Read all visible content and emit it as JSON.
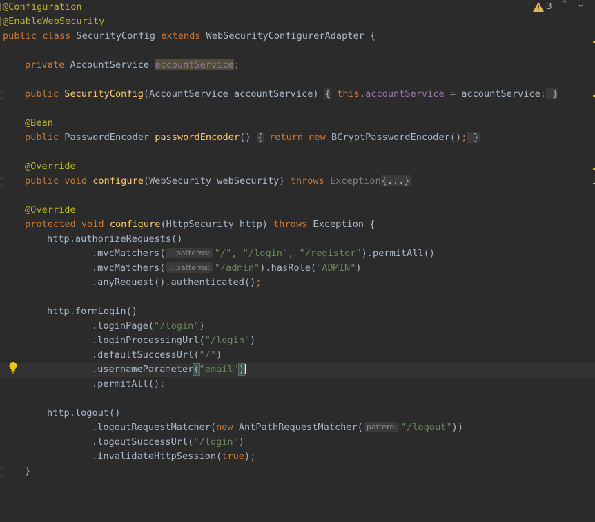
{
  "inspection": {
    "warning_count": "3",
    "up_arrow": "⌃",
    "down_arrow": "⌄"
  },
  "code": {
    "l1": {
      "a": "@Configuration"
    },
    "l2": {
      "a": "@EnableWebSecurity"
    },
    "l3": {
      "k1": "public class ",
      "name": "SecurityConfig ",
      "k2": "extends ",
      "parent": "WebSecurityConfigurerAdapter {"
    },
    "l5": {
      "k1": "private ",
      "type": "AccountService ",
      "field": "accountService",
      "semi": ";"
    },
    "l7": {
      "k1": "public ",
      "fn": "SecurityConfig",
      "args": "(AccountService accountService) ",
      "b1": "{",
      "this": " this",
      "dot": ".",
      "field": "accountService",
      "eq": " = accountService",
      "semi": ";",
      "b2": " }"
    },
    "l9": {
      "a": "@Bean"
    },
    "l10": {
      "k1": "public ",
      "type": "PasswordEncoder ",
      "fn": "passwordEncoder",
      "args": "() ",
      "b1": "{",
      "ret": " return new ",
      "ctor": "BCryptPasswordEncoder()",
      "semi": ";",
      "b2": " }"
    },
    "l12": {
      "a": "@Override"
    },
    "l13": {
      "k1": "public void ",
      "fn": "configure",
      "args": "(WebSecurity webSecurity) ",
      "k2": "throws ",
      "exc": "Exception",
      "fold": "{...}"
    },
    "l15": {
      "a": "@Override"
    },
    "l16": {
      "k1": "protected void ",
      "fn": "configure",
      "args": "(HttpSecurity http) ",
      "k2": "throws ",
      "exc": "Exception {"
    },
    "l17": {
      "t": "http.authorizeRequests()"
    },
    "l18": {
      "t1": ".mvcMatchers(",
      "hint": "...patterns:",
      "s1": "\"/\"",
      "c1": ", ",
      "s2": "\"/login\"",
      "c2": ", ",
      "s3": "\"/register\"",
      "t2": ").permitAll()"
    },
    "l19": {
      "t1": ".mvcMatchers(",
      "hint": "...patterns:",
      "s1": "\"/admin\"",
      "t2": ").hasRole(",
      "s2": "\"ADMIN\"",
      "t3": ")"
    },
    "l20": {
      "t": ".anyRequest().authenticated()",
      "semi": ";"
    },
    "l22": {
      "t": "http.formLogin()"
    },
    "l23": {
      "t1": ".loginPage(",
      "s": "\"/login\"",
      "t2": ")"
    },
    "l24": {
      "t1": ".loginProcessingUrl(",
      "s": "\"/login\"",
      "t2": ")"
    },
    "l25": {
      "t1": ".defaultSuccessUrl(",
      "s": "\"/\"",
      "t2": ")"
    },
    "l26": {
      "t1": ".usernameParameter",
      "p1": "(",
      "s": "\"email\"",
      "p2": ")"
    },
    "l27": {
      "t": ".permitAll()",
      "semi": ";"
    },
    "l29": {
      "t": "http.logout()"
    },
    "l30": {
      "t1": ".logoutRequestMatcher(",
      "k": "new ",
      "t2": "AntPathRequestMatcher(",
      "hint": "pattern:",
      "s": "\"/logout\"",
      "t3": "))"
    },
    "l31": {
      "t1": ".logoutSuccessUrl(",
      "s": "\"/login\"",
      "t2": ")"
    },
    "l32": {
      "t1": ".invalidateHttpSession(",
      "k": "true",
      "t2": ")",
      "semi": ";"
    },
    "l33": {
      "t": "}"
    }
  },
  "colors": {
    "background": "#2b2b2b",
    "keyword": "#cc7832",
    "annotation": "#bbb529",
    "string": "#6a8759",
    "function": "#ffc66d",
    "field": "#9876aa",
    "text": "#a9b7c6"
  },
  "icons": {
    "warning": "warning-triangle-icon",
    "bulb": "lightbulb-icon"
  }
}
